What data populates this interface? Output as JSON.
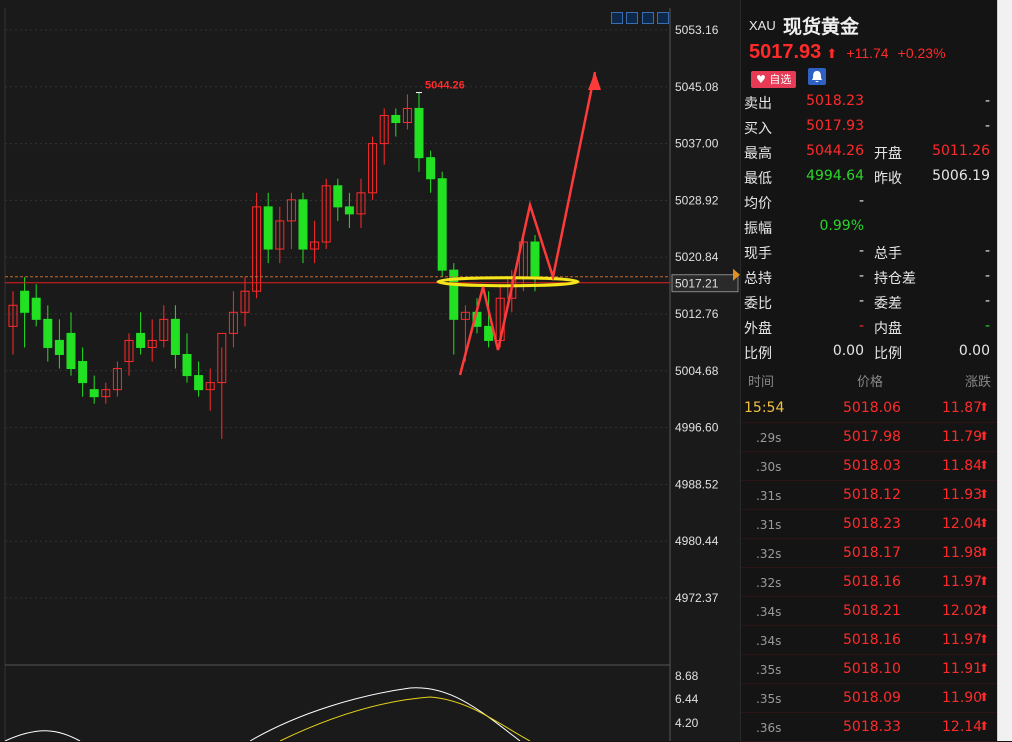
{
  "symbol": {
    "code": "XAU",
    "name": "现货黄金"
  },
  "quote": {
    "last": "5017.93",
    "change": "+11.74",
    "pct": "+0.23%",
    "arrow": "⬆"
  },
  "buttons": {
    "watch": "自选"
  },
  "table": {
    "rows": [
      {
        "l1": "卖出",
        "v1": "5018.23",
        "c1": "red",
        "l2": "",
        "v2": "-",
        "c2": "white"
      },
      {
        "l1": "买入",
        "v1": "5017.93",
        "c1": "red",
        "l2": "",
        "v2": "-",
        "c2": "white"
      },
      {
        "l1": "最高",
        "v1": "5044.26",
        "c1": "red",
        "l2": "开盘",
        "v2": "5011.26",
        "c2": "red"
      },
      {
        "l1": "最低",
        "v1": "4994.64",
        "c1": "green",
        "l2": "昨收",
        "v2": "5006.19",
        "c2": "white"
      },
      {
        "l1": "均价",
        "v1": "-",
        "c1": "white",
        "l2": "",
        "v2": "",
        "c2": "white"
      },
      {
        "l1": "振幅",
        "v1": "0.99%",
        "c1": "green",
        "l2": "",
        "v2": "",
        "c2": "white"
      },
      {
        "l1": "现手",
        "v1": "-",
        "c1": "white",
        "l2": "总手",
        "v2": "-",
        "c2": "white"
      },
      {
        "l1": "总持",
        "v1": "-",
        "c1": "white",
        "l2": "持仓差",
        "v2": "-",
        "c2": "white"
      },
      {
        "l1": "委比",
        "v1": "-",
        "c1": "white",
        "l2": "委差",
        "v2": "-",
        "c2": "white"
      },
      {
        "l1": "外盘",
        "v1": "-",
        "c1": "red",
        "l2": "内盘",
        "v2": "-",
        "c2": "green"
      },
      {
        "l1": "比例",
        "v1": "0.00",
        "c1": "white",
        "l2": "比例",
        "v2": "0.00",
        "c2": "white"
      }
    ]
  },
  "trades_header": {
    "time": "时间",
    "price": "价格",
    "change": "涨跌"
  },
  "trades": [
    {
      "time": "15:54",
      "price": "5018.06",
      "change": "11.87"
    },
    {
      "time": ".29s",
      "price": "5017.98",
      "change": "11.79"
    },
    {
      "time": ".30s",
      "price": "5018.03",
      "change": "11.84"
    },
    {
      "time": ".31s",
      "price": "5018.12",
      "change": "11.93"
    },
    {
      "time": ".31s",
      "price": "5018.23",
      "change": "12.04"
    },
    {
      "time": ".32s",
      "price": "5018.17",
      "change": "11.98"
    },
    {
      "time": ".32s",
      "price": "5018.16",
      "change": "11.97"
    },
    {
      "time": ".34s",
      "price": "5018.21",
      "change": "12.02"
    },
    {
      "time": ".34s",
      "price": "5018.16",
      "change": "11.97"
    },
    {
      "time": ".35s",
      "price": "5018.10",
      "change": "11.91"
    },
    {
      "time": ".35s",
      "price": "5018.09",
      "change": "11.90"
    },
    {
      "time": ".36s",
      "price": "5018.33",
      "change": "12.14"
    }
  ],
  "axis": {
    "price_ticks": [
      "5053.16",
      "5045.08",
      "5037.00",
      "5028.92",
      "5020.84",
      "5012.76",
      "5004.68",
      "4996.60",
      "4988.52",
      "4980.44",
      "4972.37"
    ],
    "current": "5017.21",
    "high_label": "5044.26",
    "ind_ticks": [
      "8.68",
      "6.44",
      "4.20"
    ]
  },
  "colors": {
    "up": "#ff2b2b",
    "down": "#22e022",
    "bg": "#1a1a1a",
    "highlight": "#f5e51a"
  }
}
